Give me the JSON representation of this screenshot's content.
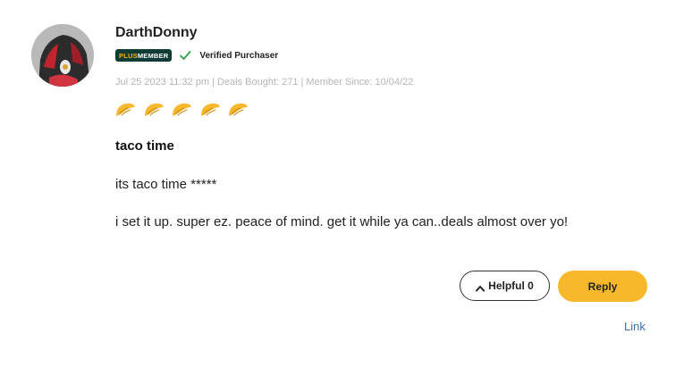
{
  "review": {
    "username": "DarthDonny",
    "badge": {
      "plus": "PLUS",
      "member": "MEMBER"
    },
    "verified_label": "Verified Purchaser",
    "meta": "Jul 25 2023 11:32 pm | Deals Bought: 271 | Member Since: 10/04/22",
    "rating": 5,
    "rating_max": 5,
    "rating_icon": "taco-icon",
    "title": "taco time",
    "body": [
      "its taco time *****",
      "i set it up. super ez. peace of mind. get it while ya can..deals almost over yo!"
    ]
  },
  "actions": {
    "helpful_label": "Helpful 0",
    "reply_label": "Reply",
    "link_label": "Link"
  },
  "colors": {
    "accent": "#f7b92b",
    "badge_bg": "#0e3b34",
    "verified_check": "#2e9e4b",
    "link": "#3f6fb3",
    "meta_text": "#b5b5b5"
  }
}
